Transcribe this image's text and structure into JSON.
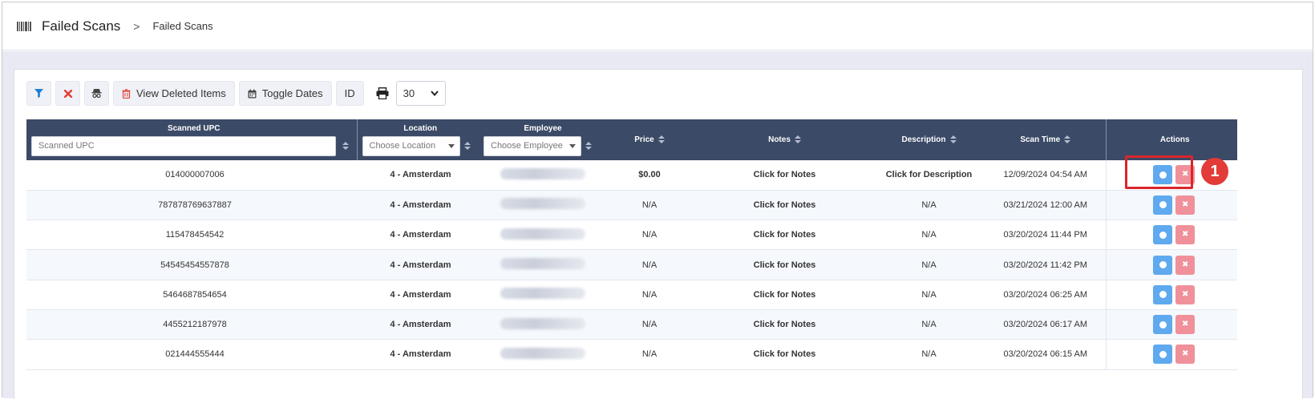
{
  "header": {
    "title": "Failed Scans",
    "separator": ">",
    "breadcrumb": "Failed Scans"
  },
  "toolbar": {
    "view_deleted_label": "View Deleted Items",
    "toggle_dates_label": "Toggle Dates",
    "id_label": "ID",
    "page_size": "30"
  },
  "table": {
    "columns": {
      "upc": "Scanned UPC",
      "location": "Location",
      "employee": "Employee",
      "price": "Price",
      "notes": "Notes",
      "description": "Description",
      "scan_time": "Scan Time",
      "actions": "Actions"
    },
    "filters": {
      "upc_placeholder": "Scanned UPC",
      "location_placeholder": "Choose Location",
      "employee_placeholder": "Choose Employee"
    },
    "rows": [
      {
        "upc": "014000007006",
        "location": "4 - Amsterdam",
        "price": "$0.00",
        "notes": "Click for Notes",
        "description": "Click for Description",
        "scan_time": "12/09/2024 04:54 AM"
      },
      {
        "upc": "787878769637887",
        "location": "4 - Amsterdam",
        "price": "N/A",
        "notes": "Click for Notes",
        "description": "N/A",
        "scan_time": "03/21/2024 12:00 AM"
      },
      {
        "upc": "115478454542",
        "location": "4 - Amsterdam",
        "price": "N/A",
        "notes": "Click for Notes",
        "description": "N/A",
        "scan_time": "03/20/2024 11:44 PM"
      },
      {
        "upc": "54545454557878",
        "location": "4 - Amsterdam",
        "price": "N/A",
        "notes": "Click for Notes",
        "description": "N/A",
        "scan_time": "03/20/2024 11:42 PM"
      },
      {
        "upc": "5464687854654",
        "location": "4 - Amsterdam",
        "price": "N/A",
        "notes": "Click for Notes",
        "description": "N/A",
        "scan_time": "03/20/2024 06:25 AM"
      },
      {
        "upc": "4455212187978",
        "location": "4 - Amsterdam",
        "price": "N/A",
        "notes": "Click for Notes",
        "description": "N/A",
        "scan_time": "03/20/2024 06:17 AM"
      },
      {
        "upc": "021444555444",
        "location": "4 - Amsterdam",
        "price": "N/A",
        "notes": "Click for Notes",
        "description": "N/A",
        "scan_time": "03/20/2024 06:15 AM"
      }
    ]
  },
  "annotation": {
    "marker": "1"
  }
}
